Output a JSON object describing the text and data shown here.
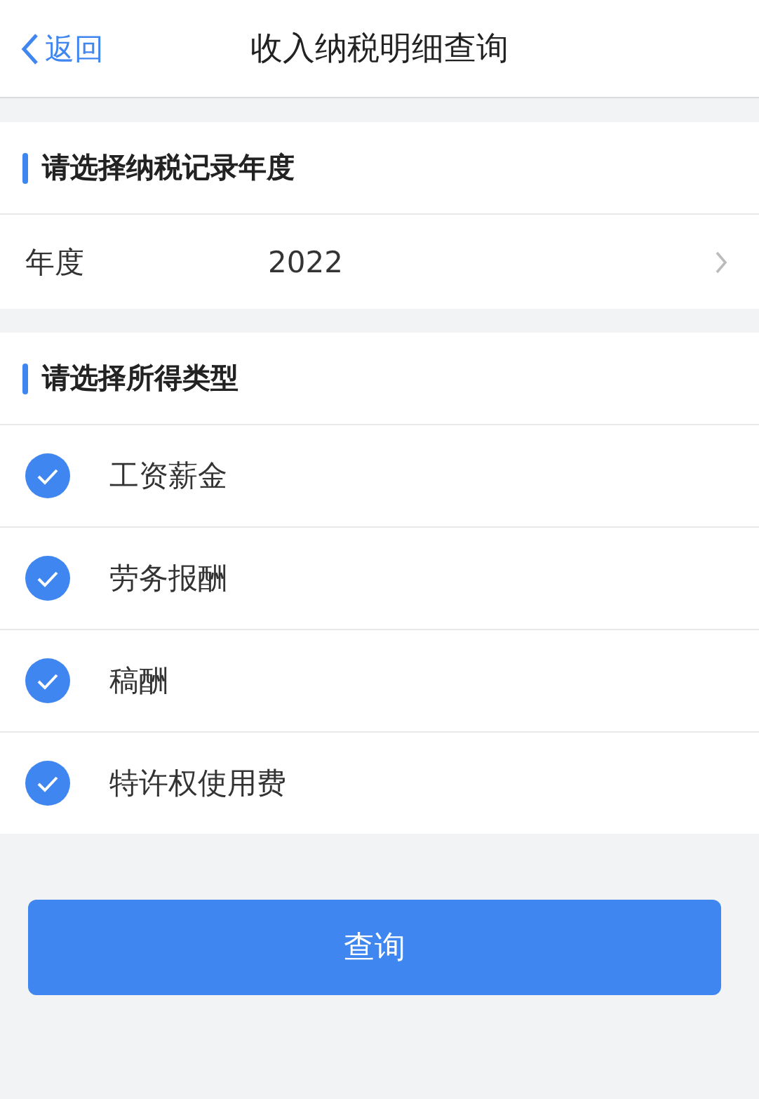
{
  "nav": {
    "back": "返回",
    "title": "收入纳税明细查询"
  },
  "year_section": {
    "title": "请选择纳税记录年度",
    "label": "年度",
    "value": "2022"
  },
  "type_section": {
    "title": "请选择所得类型",
    "items": [
      {
        "label": "工资薪金",
        "checked": true
      },
      {
        "label": "劳务报酬",
        "checked": true
      },
      {
        "label": "稿酬",
        "checked": true
      },
      {
        "label": "特许权使用费",
        "checked": true
      }
    ]
  },
  "button": "查询"
}
